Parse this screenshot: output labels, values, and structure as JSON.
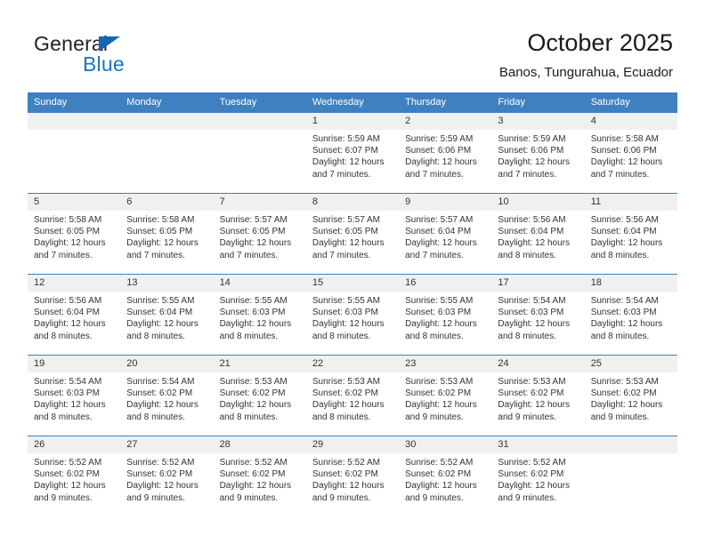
{
  "brand": {
    "name_part1": "General",
    "name_part2": "Blue",
    "triangle_icon": "triangle-icon",
    "accent_color": "#1567b3"
  },
  "header": {
    "title": "October 2025",
    "subtitle": "Banos, Tungurahua, Ecuador"
  },
  "calendar": {
    "header_bg": "#3f80c0",
    "daynum_bg": "#f0f0f0",
    "weekdays": [
      "Sunday",
      "Monday",
      "Tuesday",
      "Wednesday",
      "Thursday",
      "Friday",
      "Saturday"
    ],
    "weeks": [
      [
        {
          "day": "",
          "lines": []
        },
        {
          "day": "",
          "lines": []
        },
        {
          "day": "",
          "lines": []
        },
        {
          "day": "1",
          "lines": [
            "Sunrise: 5:59 AM",
            "Sunset: 6:07 PM",
            "Daylight: 12 hours",
            "and 7 minutes."
          ]
        },
        {
          "day": "2",
          "lines": [
            "Sunrise: 5:59 AM",
            "Sunset: 6:06 PM",
            "Daylight: 12 hours",
            "and 7 minutes."
          ]
        },
        {
          "day": "3",
          "lines": [
            "Sunrise: 5:59 AM",
            "Sunset: 6:06 PM",
            "Daylight: 12 hours",
            "and 7 minutes."
          ]
        },
        {
          "day": "4",
          "lines": [
            "Sunrise: 5:58 AM",
            "Sunset: 6:06 PM",
            "Daylight: 12 hours",
            "and 7 minutes."
          ]
        }
      ],
      [
        {
          "day": "5",
          "lines": [
            "Sunrise: 5:58 AM",
            "Sunset: 6:05 PM",
            "Daylight: 12 hours",
            "and 7 minutes."
          ]
        },
        {
          "day": "6",
          "lines": [
            "Sunrise: 5:58 AM",
            "Sunset: 6:05 PM",
            "Daylight: 12 hours",
            "and 7 minutes."
          ]
        },
        {
          "day": "7",
          "lines": [
            "Sunrise: 5:57 AM",
            "Sunset: 6:05 PM",
            "Daylight: 12 hours",
            "and 7 minutes."
          ]
        },
        {
          "day": "8",
          "lines": [
            "Sunrise: 5:57 AM",
            "Sunset: 6:05 PM",
            "Daylight: 12 hours",
            "and 7 minutes."
          ]
        },
        {
          "day": "9",
          "lines": [
            "Sunrise: 5:57 AM",
            "Sunset: 6:04 PM",
            "Daylight: 12 hours",
            "and 7 minutes."
          ]
        },
        {
          "day": "10",
          "lines": [
            "Sunrise: 5:56 AM",
            "Sunset: 6:04 PM",
            "Daylight: 12 hours",
            "and 8 minutes."
          ]
        },
        {
          "day": "11",
          "lines": [
            "Sunrise: 5:56 AM",
            "Sunset: 6:04 PM",
            "Daylight: 12 hours",
            "and 8 minutes."
          ]
        }
      ],
      [
        {
          "day": "12",
          "lines": [
            "Sunrise: 5:56 AM",
            "Sunset: 6:04 PM",
            "Daylight: 12 hours",
            "and 8 minutes."
          ]
        },
        {
          "day": "13",
          "lines": [
            "Sunrise: 5:55 AM",
            "Sunset: 6:04 PM",
            "Daylight: 12 hours",
            "and 8 minutes."
          ]
        },
        {
          "day": "14",
          "lines": [
            "Sunrise: 5:55 AM",
            "Sunset: 6:03 PM",
            "Daylight: 12 hours",
            "and 8 minutes."
          ]
        },
        {
          "day": "15",
          "lines": [
            "Sunrise: 5:55 AM",
            "Sunset: 6:03 PM",
            "Daylight: 12 hours",
            "and 8 minutes."
          ]
        },
        {
          "day": "16",
          "lines": [
            "Sunrise: 5:55 AM",
            "Sunset: 6:03 PM",
            "Daylight: 12 hours",
            "and 8 minutes."
          ]
        },
        {
          "day": "17",
          "lines": [
            "Sunrise: 5:54 AM",
            "Sunset: 6:03 PM",
            "Daylight: 12 hours",
            "and 8 minutes."
          ]
        },
        {
          "day": "18",
          "lines": [
            "Sunrise: 5:54 AM",
            "Sunset: 6:03 PM",
            "Daylight: 12 hours",
            "and 8 minutes."
          ]
        }
      ],
      [
        {
          "day": "19",
          "lines": [
            "Sunrise: 5:54 AM",
            "Sunset: 6:03 PM",
            "Daylight: 12 hours",
            "and 8 minutes."
          ]
        },
        {
          "day": "20",
          "lines": [
            "Sunrise: 5:54 AM",
            "Sunset: 6:02 PM",
            "Daylight: 12 hours",
            "and 8 minutes."
          ]
        },
        {
          "day": "21",
          "lines": [
            "Sunrise: 5:53 AM",
            "Sunset: 6:02 PM",
            "Daylight: 12 hours",
            "and 8 minutes."
          ]
        },
        {
          "day": "22",
          "lines": [
            "Sunrise: 5:53 AM",
            "Sunset: 6:02 PM",
            "Daylight: 12 hours",
            "and 8 minutes."
          ]
        },
        {
          "day": "23",
          "lines": [
            "Sunrise: 5:53 AM",
            "Sunset: 6:02 PM",
            "Daylight: 12 hours",
            "and 9 minutes."
          ]
        },
        {
          "day": "24",
          "lines": [
            "Sunrise: 5:53 AM",
            "Sunset: 6:02 PM",
            "Daylight: 12 hours",
            "and 9 minutes."
          ]
        },
        {
          "day": "25",
          "lines": [
            "Sunrise: 5:53 AM",
            "Sunset: 6:02 PM",
            "Daylight: 12 hours",
            "and 9 minutes."
          ]
        }
      ],
      [
        {
          "day": "26",
          "lines": [
            "Sunrise: 5:52 AM",
            "Sunset: 6:02 PM",
            "Daylight: 12 hours",
            "and 9 minutes."
          ]
        },
        {
          "day": "27",
          "lines": [
            "Sunrise: 5:52 AM",
            "Sunset: 6:02 PM",
            "Daylight: 12 hours",
            "and 9 minutes."
          ]
        },
        {
          "day": "28",
          "lines": [
            "Sunrise: 5:52 AM",
            "Sunset: 6:02 PM",
            "Daylight: 12 hours",
            "and 9 minutes."
          ]
        },
        {
          "day": "29",
          "lines": [
            "Sunrise: 5:52 AM",
            "Sunset: 6:02 PM",
            "Daylight: 12 hours",
            "and 9 minutes."
          ]
        },
        {
          "day": "30",
          "lines": [
            "Sunrise: 5:52 AM",
            "Sunset: 6:02 PM",
            "Daylight: 12 hours",
            "and 9 minutes."
          ]
        },
        {
          "day": "31",
          "lines": [
            "Sunrise: 5:52 AM",
            "Sunset: 6:02 PM",
            "Daylight: 12 hours",
            "and 9 minutes."
          ]
        },
        {
          "day": "",
          "lines": []
        }
      ]
    ]
  }
}
